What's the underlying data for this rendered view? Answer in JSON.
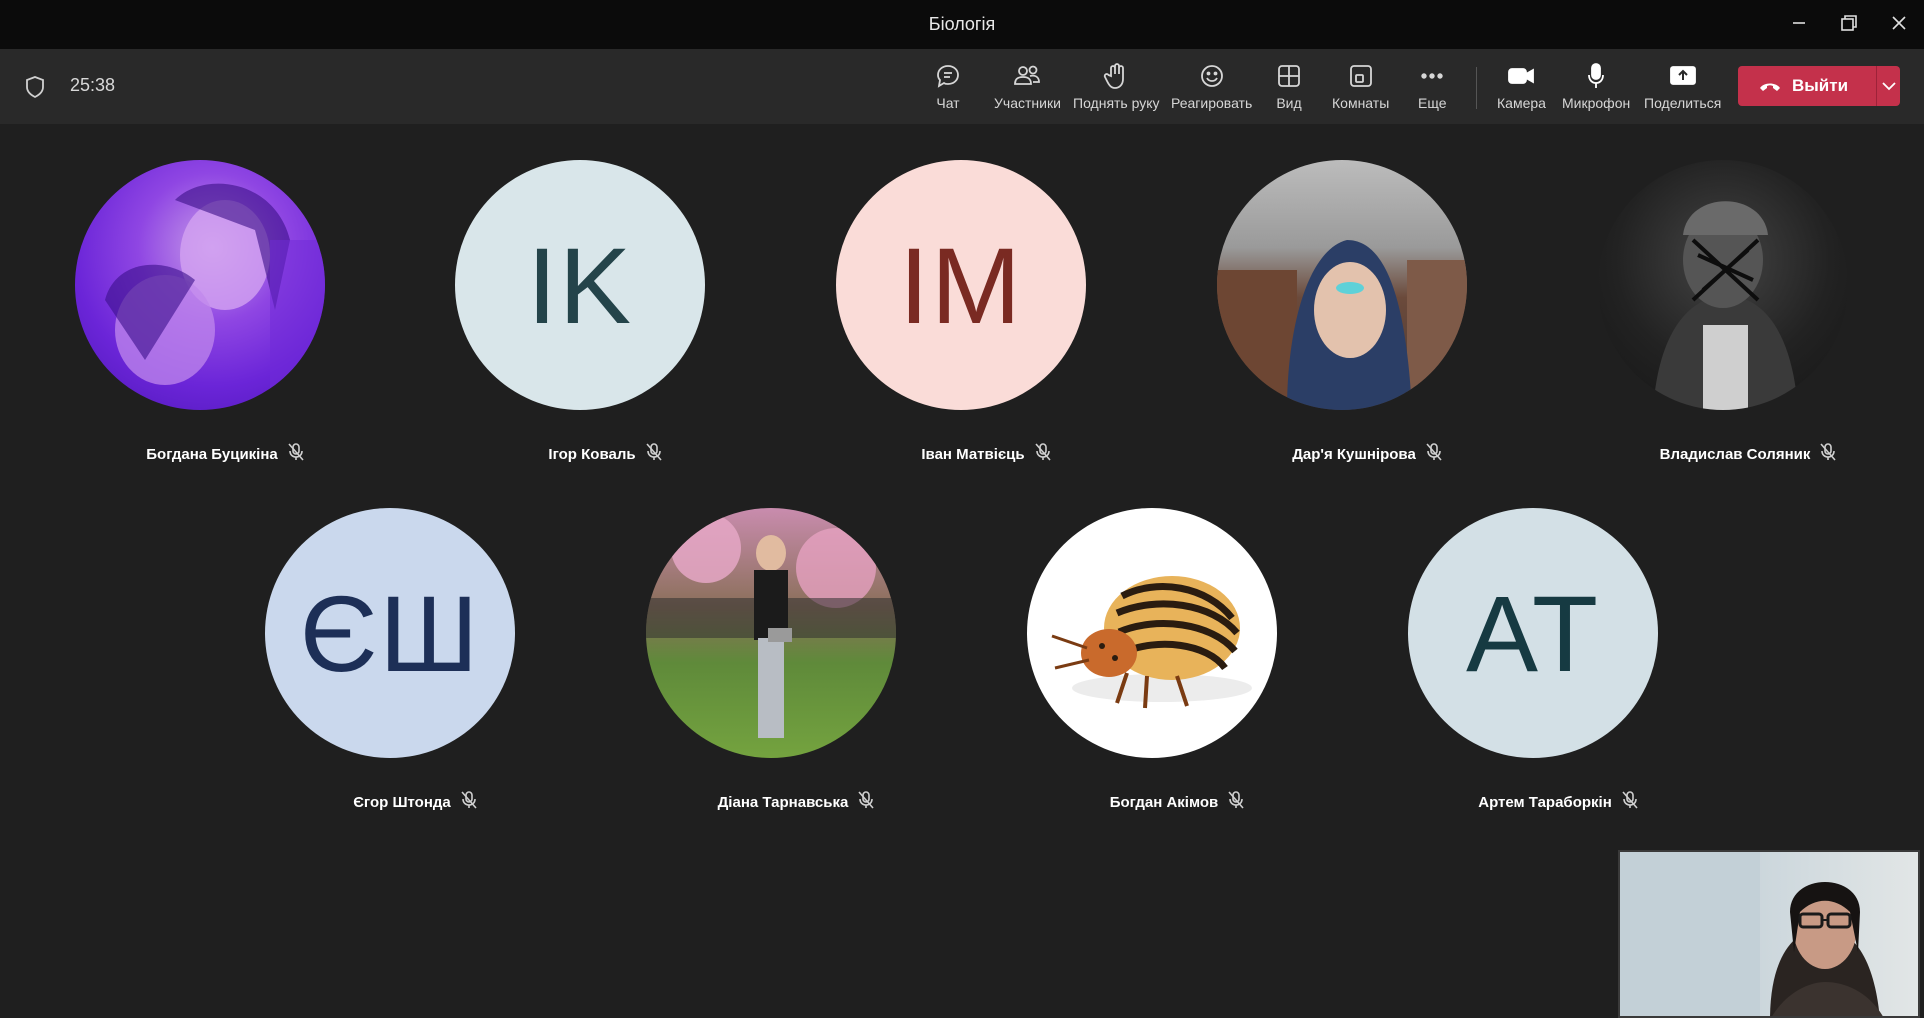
{
  "window": {
    "title": "Біологія"
  },
  "toolbar": {
    "timer": "25:38",
    "buttons": [
      {
        "id": "chat",
        "label": "Чат",
        "icon": "chat-icon"
      },
      {
        "id": "participants",
        "label": "Участники",
        "icon": "people-icon"
      },
      {
        "id": "raise-hand",
        "label": "Поднять руку",
        "icon": "hand-icon"
      },
      {
        "id": "react",
        "label": "Реагировать",
        "icon": "smile-icon"
      },
      {
        "id": "view",
        "label": "Вид",
        "icon": "grid-icon"
      },
      {
        "id": "rooms",
        "label": "Комнаты",
        "icon": "rooms-icon"
      },
      {
        "id": "more",
        "label": "Еще",
        "icon": "more-icon"
      },
      {
        "id": "camera",
        "label": "Камера",
        "icon": "camera-icon"
      },
      {
        "id": "mic",
        "label": "Микрофон",
        "icon": "mic-icon"
      },
      {
        "id": "share",
        "label": "Поделиться",
        "icon": "share-icon"
      }
    ],
    "leave_label": "Выйти"
  },
  "participants": [
    {
      "name": "Богдана Буцикіна",
      "avatar": "photo",
      "muted": true
    },
    {
      "name": "Ігор Коваль",
      "initials": "IK",
      "bg": "#d9e6ea",
      "fg": "#24444a",
      "muted": true
    },
    {
      "name": "Іван Матвієць",
      "initials": "IM",
      "bg": "#fadcd8",
      "fg": "#7a2a22",
      "muted": true
    },
    {
      "name": "Дар'я Кушнірова",
      "avatar": "photo",
      "muted": true
    },
    {
      "name": "Владислав Соляник",
      "avatar": "photo",
      "muted": true
    },
    {
      "name": "Єгор Штонда",
      "initials": "ЄШ",
      "bg": "#cad8ed",
      "fg": "#1d2f57",
      "muted": true
    },
    {
      "name": "Діана Тарнавська",
      "avatar": "photo",
      "muted": true
    },
    {
      "name": "Богдан Акімов",
      "avatar": "photo",
      "muted": true
    },
    {
      "name": "Артем Тараборкін",
      "initials": "AT",
      "bg": "#d3e0e6",
      "fg": "#163a42",
      "muted": true
    }
  ],
  "colors": {
    "leave": "#c4314b",
    "background": "#1f1f1f",
    "toolbar": "#292929"
  }
}
